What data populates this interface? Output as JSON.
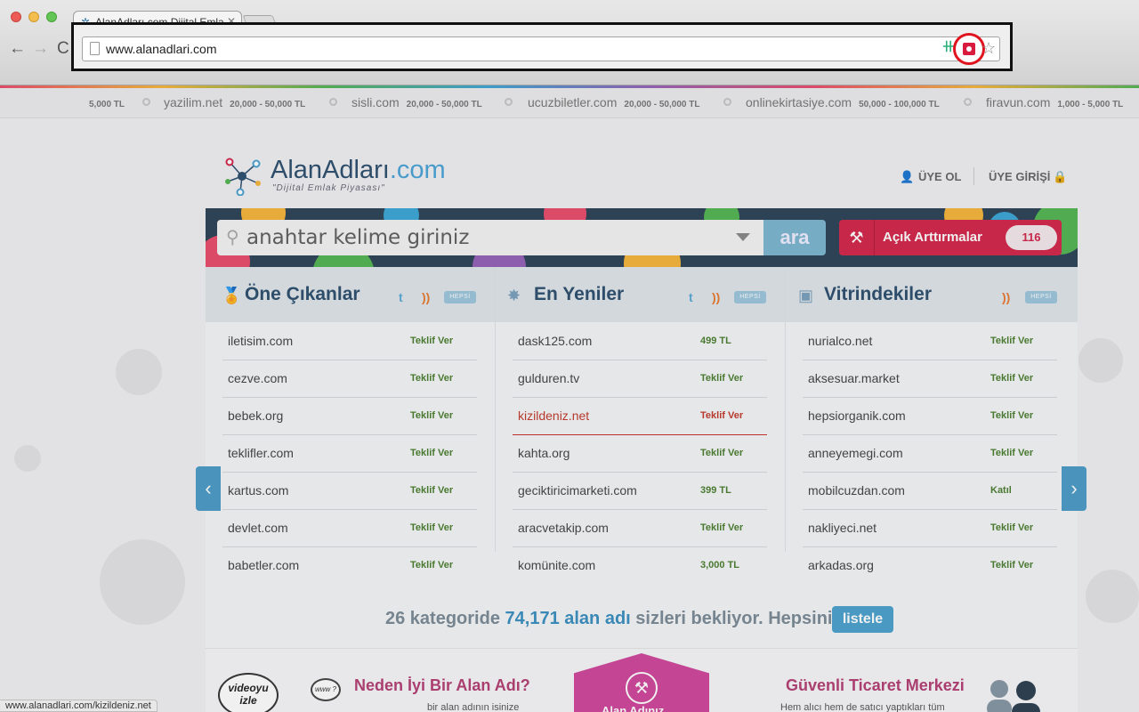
{
  "browser": {
    "tab_title": "AlanAdları.com Dijital Emlak",
    "tab_close": "✕",
    "url": "www.alanadlari.com",
    "back": "←",
    "forward": "→",
    "reload": "C"
  },
  "ticker": [
    {
      "name": "",
      "price": "5,000 TL"
    },
    {
      "name": "yazilim.net",
      "price": "20,000 - 50,000 TL"
    },
    {
      "name": "sisli.com",
      "price": "20,000 - 50,000 TL"
    },
    {
      "name": "ucuzbiletler.com",
      "price": "20,000 - 50,000 TL"
    },
    {
      "name": "onlinekirtasiye.com",
      "price": "50,000 - 100,000 TL"
    },
    {
      "name": "firavun.com",
      "price": "1,000 - 5,000 TL"
    }
  ],
  "header": {
    "logo_main": "AlanAdları",
    "logo_tld": ".com",
    "slogan": "\"Dijital Emlak Piyasası\"",
    "register": "ÜYE OL",
    "login": "ÜYE GİRİŞİ"
  },
  "search": {
    "placeholder": "anahtar kelime giriniz",
    "button": "ara",
    "auction_label": "Açık Arttırmalar",
    "auction_count": "116"
  },
  "columns": [
    {
      "title": "Öne Çıkanlar",
      "hepsi": "HEPSİ",
      "rows": [
        {
          "domain": "iletisim.com",
          "action": "Teklif Ver"
        },
        {
          "domain": "cezve.com",
          "action": "Teklif Ver"
        },
        {
          "domain": "bebek.org",
          "action": "Teklif Ver"
        },
        {
          "domain": "teklifler.com",
          "action": "Teklif Ver"
        },
        {
          "domain": "kartus.com",
          "action": "Teklif Ver"
        },
        {
          "domain": "devlet.com",
          "action": "Teklif Ver"
        },
        {
          "domain": "babetler.com",
          "action": "Teklif Ver"
        }
      ]
    },
    {
      "title": "En Yeniler",
      "hepsi": "HEPSİ",
      "rows": [
        {
          "domain": "dask125.com",
          "action": "499 TL"
        },
        {
          "domain": "gulduren.tv",
          "action": "Teklif Ver"
        },
        {
          "domain": "kizildeniz.net",
          "action": "Teklif Ver"
        },
        {
          "domain": "kahta.org",
          "action": "Teklif Ver"
        },
        {
          "domain": "geciktiricimarketi.com",
          "action": "399 TL"
        },
        {
          "domain": "aracvetakip.com",
          "action": "Teklif Ver"
        },
        {
          "domain": "komünite.com",
          "action": "3,000 TL"
        }
      ]
    },
    {
      "title": "Vitrindekiler",
      "hepsi": "HEPSİ",
      "rows": [
        {
          "domain": "nurialco.net",
          "action": "Teklif Ver"
        },
        {
          "domain": "aksesuar.market",
          "action": "Teklif Ver"
        },
        {
          "domain": "hepsiorganik.com",
          "action": "Teklif Ver"
        },
        {
          "domain": "anneyemegi.com",
          "action": "Teklif Ver"
        },
        {
          "domain": "mobilcuzdan.com",
          "action": "Katıl"
        },
        {
          "domain": "nakliyeci.net",
          "action": "Teklif Ver"
        },
        {
          "domain": "arkadas.org",
          "action": "Teklif Ver"
        }
      ]
    }
  ],
  "summary": {
    "part1": "26 kategoride ",
    "count": "74,171 alan adı",
    "part2": " sizleri bekliyor. Hepsini",
    "button": "listele"
  },
  "promo": {
    "video_bubble": "videoyu izle",
    "www_bubble": "www ?",
    "left_title": "Neden İyi Bir Alan Adı?",
    "left_text": "bir alan adının isinize",
    "center_label": "Alan Adınız",
    "right_title": "Güvenli Ticaret Merkezi",
    "right_text": "Hem alıcı hem de satıcı yaptıkları tüm"
  },
  "status_bar": "www.alanadlari.com/kizildeniz.net",
  "icons": {
    "arrow_left": "‹",
    "arrow_right": "›",
    "search": "🔍",
    "gavel": "⚒",
    "star": "☆",
    "twitter": "🐦",
    "rss": "◉"
  },
  "colors": {
    "brand_blue": "#2c4f6e",
    "accent_blue": "#4aa1cf",
    "auction_red": "#d3264b",
    "offer_green": "#4a7e2f",
    "highlight_red": "#c0392b",
    "promo_pink": "#d0469b"
  }
}
